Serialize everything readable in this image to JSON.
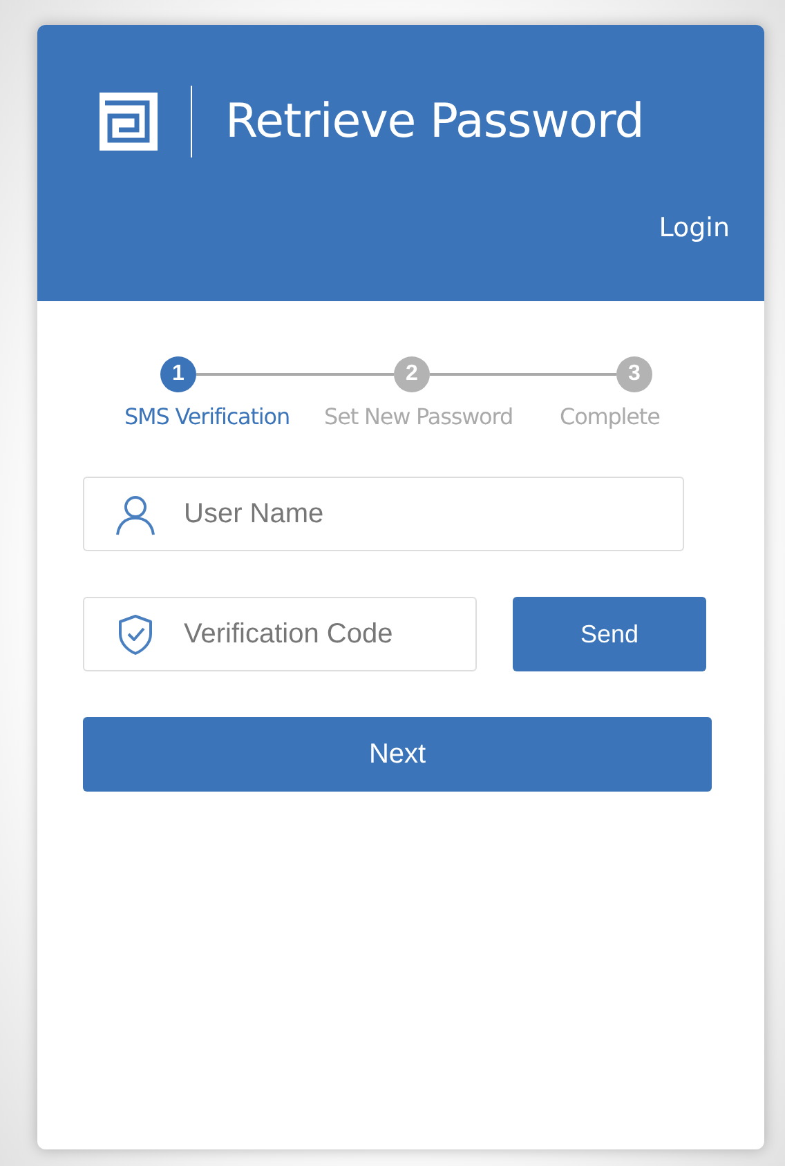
{
  "header": {
    "title": "Retrieve Password",
    "login_link": "Login"
  },
  "steps": [
    {
      "number": "1",
      "label": "SMS Verification",
      "selected": true
    },
    {
      "number": "2",
      "label": "Set New Password",
      "selected": false
    },
    {
      "number": "3",
      "label": "Complete",
      "selected": false
    }
  ],
  "form": {
    "username": {
      "placeholder": "User Name"
    },
    "code": {
      "placeholder": "Verification Code"
    },
    "send_button": "Send",
    "next_button": "Next"
  }
}
